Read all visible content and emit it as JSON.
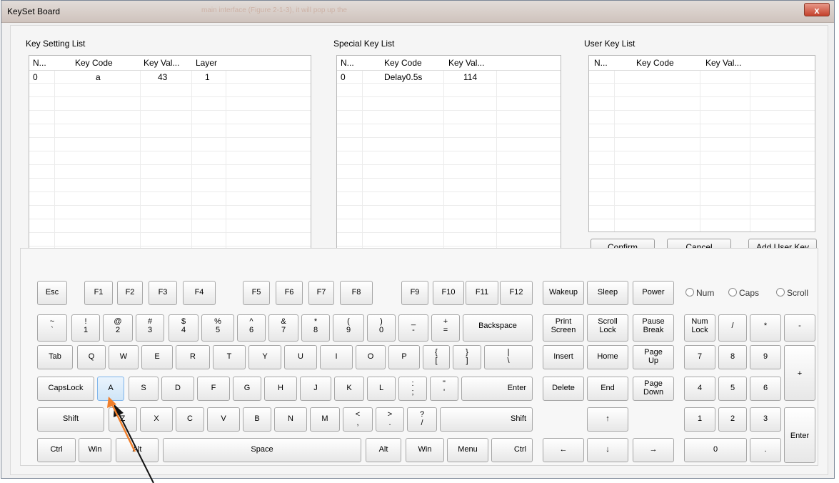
{
  "window": {
    "title": "KeySet Board",
    "title_blur": "main interface (Figure 2-1-3), it will pop up the",
    "close": "x"
  },
  "key_setting": {
    "title": "Key Setting List",
    "headers": [
      "N...",
      "Key Code",
      "Key Val...",
      "Layer"
    ],
    "rows": [
      [
        "0",
        "a",
        "43",
        "1"
      ]
    ]
  },
  "special_key": {
    "title": "Special Key List",
    "headers": [
      "N...",
      "Key Code",
      "Key Val..."
    ],
    "rows": [
      [
        "0",
        "Delay0.5s",
        "114"
      ]
    ]
  },
  "user_key": {
    "title": "User Key List",
    "headers": [
      "N...",
      "Key Code",
      "Key Val..."
    ],
    "rows": []
  },
  "buttons": {
    "confirm": "Confirm",
    "cancel": "Cancel",
    "add_user_key": "Add User Key"
  },
  "locks": {
    "num": "Num",
    "caps": "Caps",
    "scroll": "Scroll"
  },
  "keys": {
    "esc": "Esc",
    "f1": "F1",
    "f2": "F2",
    "f3": "F3",
    "f4": "F4",
    "f5": "F5",
    "f6": "F6",
    "f7": "F7",
    "f8": "F8",
    "f9": "F9",
    "f10": "F10",
    "f11": "F11",
    "f12": "F12",
    "wakeup": "Wakeup",
    "sleep": "Sleep",
    "power": "Power",
    "tilde": "~\n`",
    "d1": "!\n1",
    "d2": "@\n2",
    "d3": "#\n3",
    "d4": "$\n4",
    "d5": "%\n5",
    "d6": "^\n6",
    "d7": "&\n7",
    "d8": "*\n8",
    "d9": "(\n9",
    "d0": ")\n0",
    "minus": "_\n-",
    "equal": "+\n=",
    "backspace": "Backspace",
    "print_screen": "Print\nScreen",
    "scroll_lock": "Scroll\nLock",
    "pause_break": "Pause\nBreak",
    "num_lock": "Num\nLock",
    "np_slash": "/",
    "np_star": "*",
    "np_minus": "-",
    "tab": "Tab",
    "q": "Q",
    "w": "W",
    "e": "E",
    "r": "R",
    "t": "T",
    "y": "Y",
    "u": "U",
    "i": "I",
    "o": "O",
    "p": "P",
    "lbracket": "{\n[",
    "rbracket": "}\n]",
    "backslash": "|\n\\",
    "insert": "Insert",
    "home": "Home",
    "page_up": "Page\nUp",
    "np7": "7",
    "np8": "8",
    "np9": "9",
    "np_plus": "+",
    "capslock": "CapsLock",
    "a": "A",
    "s": "S",
    "d": "D",
    "f": "F",
    "g": "G",
    "h": "H",
    "j": "J",
    "k": "K",
    "l": "L",
    "semicolon": ":\n;",
    "quote": "\"\n'",
    "enter": "Enter",
    "delete": "Delete",
    "end": "End",
    "page_down": "Page\nDown",
    "np4": "4",
    "np5": "5",
    "np6": "6",
    "lshift": "Shift",
    "z": "Z",
    "x": "X",
    "c": "C",
    "v": "V",
    "b": "B",
    "n": "N",
    "m": "M",
    "comma": "<\n,",
    "period": ">\n.",
    "slash": "?\n/",
    "rshift": "Shift",
    "up": "↑",
    "np1": "1",
    "np2": "2",
    "np3": "3",
    "np_enter": "Enter",
    "lctrl": "Ctrl",
    "lwin": "Win",
    "lalt": "Alt",
    "space": "Space",
    "ralt": "Alt",
    "rwin": "Win",
    "menu": "Menu",
    "rctrl": "Ctrl",
    "left": "←",
    "down": "↓",
    "right": "→",
    "np0": "0",
    "np_dot": "."
  }
}
